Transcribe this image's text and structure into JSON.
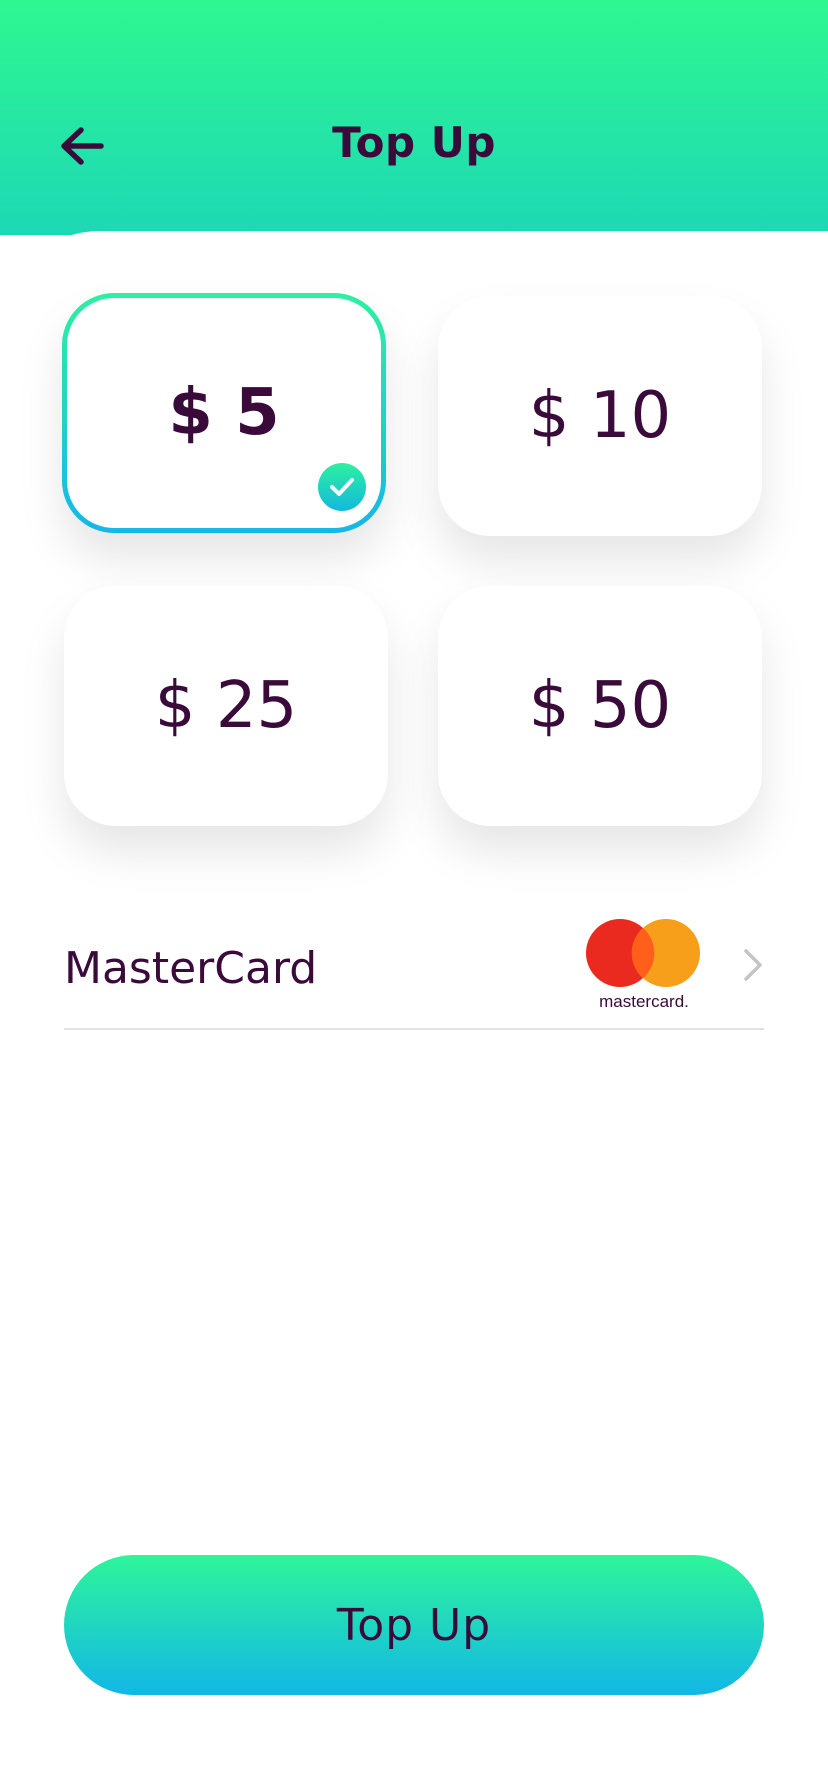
{
  "header": {
    "title": "Top Up",
    "back_icon": "arrow-left-icon"
  },
  "amounts": [
    {
      "label": "$ 5",
      "selected": true
    },
    {
      "label": "$ 10",
      "selected": false
    },
    {
      "label": "$ 25",
      "selected": false
    },
    {
      "label": "$ 50",
      "selected": false
    }
  ],
  "payment": {
    "method_label": "MasterCard",
    "logo_text": "mastercard.",
    "chevron_icon": "chevron-right-icon"
  },
  "cta": {
    "label": "Top Up"
  },
  "colors": {
    "accent_top": "#2ef791",
    "accent_bottom": "#12b7e6",
    "text": "#3a0a3a",
    "mastercard_red": "#eb2a1f",
    "mastercard_orange": "#f79e1b"
  }
}
